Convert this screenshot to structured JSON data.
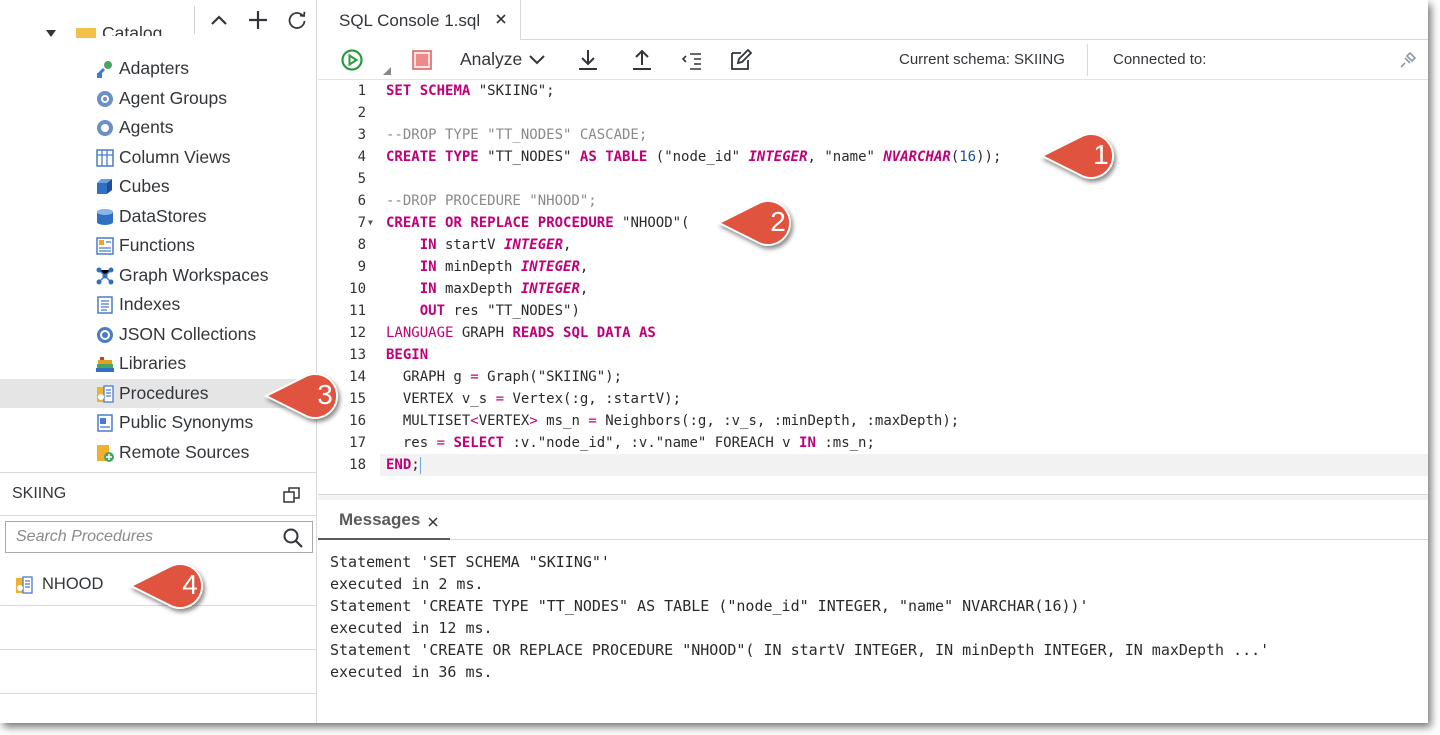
{
  "left_panel": {
    "catalog_label": "Catalog",
    "tree_items": [
      {
        "label": "Adapters",
        "icon": "adapters-icon"
      },
      {
        "label": "Agent Groups",
        "icon": "agent-groups-icon"
      },
      {
        "label": "Agents",
        "icon": "agents-icon"
      },
      {
        "label": "Column Views",
        "icon": "column-views-icon"
      },
      {
        "label": "Cubes",
        "icon": "cubes-icon"
      },
      {
        "label": "DataStores",
        "icon": "datastores-icon"
      },
      {
        "label": "Functions",
        "icon": "functions-icon"
      },
      {
        "label": "Graph Workspaces",
        "icon": "graph-workspaces-icon"
      },
      {
        "label": "Indexes",
        "icon": "indexes-icon"
      },
      {
        "label": "JSON Collections",
        "icon": "json-collections-icon"
      },
      {
        "label": "Libraries",
        "icon": "libraries-icon"
      },
      {
        "label": "Procedures",
        "icon": "procedures-icon",
        "selected": true
      },
      {
        "label": "Public Synonyms",
        "icon": "public-synonyms-icon"
      },
      {
        "label": "Remote Sources",
        "icon": "remote-sources-icon"
      }
    ],
    "schema_label": "SKIING",
    "search_placeholder": "Search Procedures",
    "results": [
      {
        "label": "NHOOD"
      }
    ]
  },
  "editor_tab": {
    "title": "SQL Console 1.sql"
  },
  "toolbar": {
    "analyze_label": "Analyze",
    "current_schema": "Current schema: SKIING",
    "connected_to": "Connected to:"
  },
  "line_numbers": [
    "1",
    "2",
    "3",
    "4",
    "5",
    "6",
    "7",
    "8",
    "9",
    "10",
    "11",
    "12",
    "13",
    "14",
    "15",
    "16",
    "17",
    "18"
  ],
  "messages_tab": {
    "label": "Messages"
  },
  "messages": [
    "Statement 'SET SCHEMA \"SKIING\"'",
    "executed in 2 ms.",
    "Statement 'CREATE TYPE \"TT_NODES\" AS TABLE (\"node_id\" INTEGER, \"name\" NVARCHAR(16))'",
    "executed in 12 ms.",
    "Statement 'CREATE OR REPLACE PROCEDURE \"NHOOD\"( IN startV INTEGER, IN minDepth INTEGER, IN maxDepth ...'",
    "executed in 36 ms."
  ],
  "callouts": [
    "1",
    "2",
    "3",
    "4"
  ],
  "colors": {
    "callout": "#e0533f",
    "keyword": "#c0007a",
    "run_green": "#2b9a3f",
    "stop_red": "#e05a5a"
  },
  "code": {
    "l1": {
      "k1": "SET",
      "k2": "SCHEMA",
      "t": " \"SKIING\";"
    },
    "l3": "--DROP TYPE \"TT_NODES\" CASCADE;",
    "l4": {
      "k1": "CREATE",
      "k2": "TYPE",
      "t1": " \"TT_NODES\" ",
      "k3": "AS",
      "k4": "TABLE",
      "t2": " (\"node_id\" ",
      "ty1": "INTEGER",
      "t3": ", \"name\" ",
      "ty2": "NVARCHAR",
      "t4": "(",
      "n": "16",
      "t5": "));"
    },
    "l6": "--DROP PROCEDURE \"NHOOD\";",
    "l7": {
      "k1": "CREATE",
      "k2": "OR",
      "k3": "REPLACE",
      "k4": "PROCEDURE",
      "t": " \"NHOOD\"("
    },
    "l8": {
      "k": "IN",
      "t": " startV ",
      "ty": "INTEGER",
      "e": ","
    },
    "l9": {
      "k": "IN",
      "t": " minDepth ",
      "ty": "INTEGER",
      "e": ","
    },
    "l10": {
      "k": "IN",
      "t": " maxDepth ",
      "ty": "INTEGER",
      "e": ","
    },
    "l11": {
      "k": "OUT",
      "t": " res \"TT_NODES\")"
    },
    "l12": {
      "k1": "LANGUAGE",
      "t1": " GRAPH ",
      "k2": "READS",
      "k3": "SQL",
      "k4": "DATA",
      "k5": "AS"
    },
    "l13": "BEGIN",
    "l14": {
      "t1": "GRAPH g ",
      "op": "=",
      "t2": " Graph(\"SKIING\");"
    },
    "l15": {
      "t1": "VERTEX v_s ",
      "op": "=",
      "t2": " Vertex(:g, :startV);"
    },
    "l16": {
      "t1": "MULTISET",
      "op1": "<",
      "t2": "VERTEX",
      "op2": ">",
      "t3": " ms_n ",
      "op3": "=",
      "t4": " Neighbors(:g, :v_s, :minDepth, :maxDepth);"
    },
    "l17": {
      "t1": "res ",
      "op": "=",
      "k1": "SELECT",
      "t2": " :v.\"node_id\", :v.\"name\" FOREACH v ",
      "k2": "IN",
      "t3": " :ms_n;"
    },
    "l18": {
      "k": "END",
      "t": ";"
    }
  }
}
